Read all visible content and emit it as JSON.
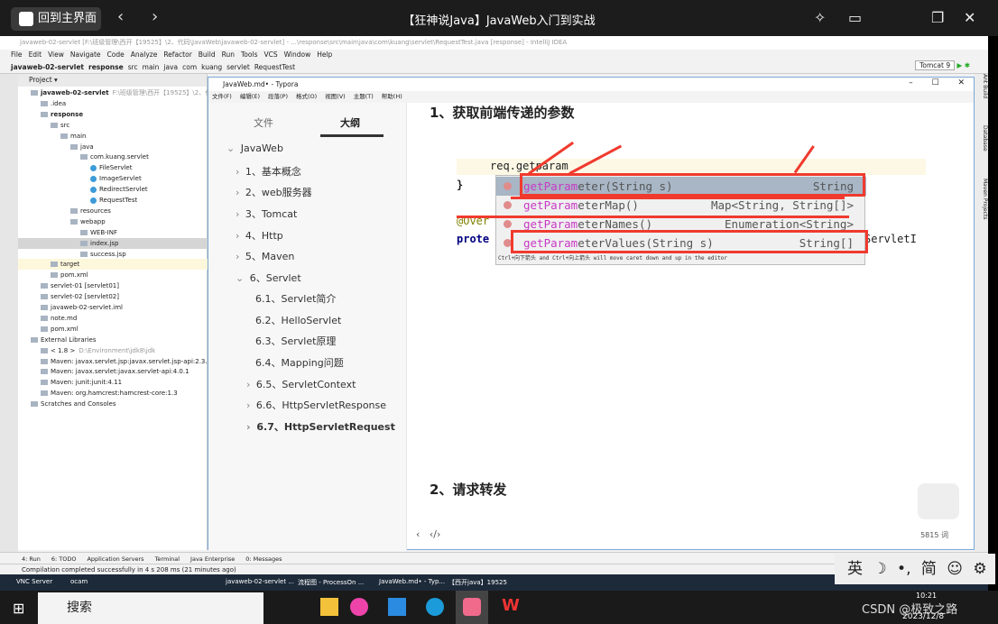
{
  "player": {
    "home_label": "回到主界面",
    "title": "【狂神说Java】JavaWeb入门到实战"
  },
  "ide": {
    "title": "javaweb-02-servlet [F:\\班级管理\\西开【19525】\\2、代码\\JavaWeb\\javaweb-02-servlet] - ...\\response\\src\\main\\java\\com\\kuang\\servlet\\RequestTest.java [response] - IntelliJ IDEA",
    "menu": [
      "File",
      "Edit",
      "View",
      "Navigate",
      "Code",
      "Analyze",
      "Refactor",
      "Build",
      "Run",
      "Tools",
      "VCS",
      "Window",
      "Help"
    ],
    "breadcrumbs": [
      "javaweb-02-servlet",
      "response",
      "src",
      "main",
      "java",
      "com",
      "kuang",
      "servlet",
      "RequestTest"
    ],
    "run_config": "Tomcat 9",
    "project_label": "Project",
    "tree": [
      {
        "t": "javaweb-02-servlet",
        "sub": "F:\\班级管理\\西开【19525】\\2、代码\\J",
        "d": 0,
        "b": true
      },
      {
        "t": ".idea",
        "d": 1
      },
      {
        "t": "response",
        "d": 1,
        "b": true
      },
      {
        "t": "src",
        "d": 2
      },
      {
        "t": "main",
        "d": 3
      },
      {
        "t": "java",
        "d": 4
      },
      {
        "t": "com.kuang.servlet",
        "d": 5
      },
      {
        "t": "FileServlet",
        "d": 6,
        "c": true
      },
      {
        "t": "ImageServlet",
        "d": 6,
        "c": true
      },
      {
        "t": "RedirectServlet",
        "d": 6,
        "c": true
      },
      {
        "t": "RequestTest",
        "d": 6,
        "c": true
      },
      {
        "t": "resources",
        "d": 4
      },
      {
        "t": "webapp",
        "d": 4
      },
      {
        "t": "WEB-INF",
        "d": 5
      },
      {
        "t": "index.jsp",
        "d": 5,
        "sel": true
      },
      {
        "t": "success.jsp",
        "d": 5
      },
      {
        "t": "target",
        "d": 2,
        "tg": true
      },
      {
        "t": "pom.xml",
        "d": 2
      },
      {
        "t": "servlet-01 [servlet01]",
        "d": 1
      },
      {
        "t": "servlet-02 [servlet02]",
        "d": 1
      },
      {
        "t": "javaweb-02-servlet.iml",
        "d": 1
      },
      {
        "t": "note.md",
        "d": 1
      },
      {
        "t": "pom.xml",
        "d": 1
      },
      {
        "t": "External Libraries",
        "d": 0
      },
      {
        "t": "< 1.8 >",
        "sub": "D:\\Environment\\jdk8\\jdk",
        "d": 1
      },
      {
        "t": "Maven: javax.servlet.jsp:javax.servlet.jsp-api:2.3.3",
        "d": 1
      },
      {
        "t": "Maven: javax.servlet:javax.servlet-api:4.0.1",
        "d": 1
      },
      {
        "t": "Maven: junit:junit:4.11",
        "d": 1
      },
      {
        "t": "Maven: org.hamcrest:hamcrest-core:1.3",
        "d": 1
      },
      {
        "t": "Scratches and Consoles",
        "d": 0
      }
    ],
    "right_tools": [
      "Ant Build",
      "Database",
      "Maven Projects"
    ],
    "bottom_tabs": [
      "4: Run",
      "6: TODO",
      "Application Servers",
      "Terminal",
      "Java Enterprise",
      "0: Messages"
    ],
    "status": "Compilation completed successfully in 4 s 208 ms (21 minutes ago)"
  },
  "typora": {
    "title": "JavaWeb.md• - Typora",
    "menu": [
      "文件(F)",
      "编辑(E)",
      "段落(P)",
      "格式(O)",
      "视图(V)",
      "主题(T)",
      "帮助(H)"
    ],
    "tabs": [
      "文件",
      "大纲"
    ],
    "outline": [
      "JavaWeb",
      "1、基本概念",
      "2、web服务器",
      "3、Tomcat",
      "4、Http",
      "5、Maven",
      "6、Servlet",
      "6.1、Servlet简介",
      "6.2、HelloServlet",
      "6.3、Servlet原理",
      "6.4、Mapping问题",
      "6.5、ServletContext",
      "6.6、HttpServletResponse",
      "6.7、HttpServletRequest"
    ],
    "heading1": "1、获取前端传递的参数",
    "heading2": "2、请求转发",
    "word_count": "5815 词",
    "code": {
      "line": "req.getparam",
      "brace": "}",
      "override": "@Over",
      "prote": "prote",
      "servlet": "ServletI",
      "completion": [
        {
          "hl": "getParam",
          "rest": "eter(String s)",
          "type": "String"
        },
        {
          "hl": "getParam",
          "rest": "eterMap()",
          "type": "Map<String, String[]>"
        },
        {
          "hl": "getParam",
          "rest": "eterNames()",
          "type": "Enumeration<String>"
        },
        {
          "hl": "getParam",
          "rest": "eterValues(String s)",
          "type": "String[]"
        }
      ],
      "hint": "Ctrl+向下箭头 and Ctrl+向上箭头 will move caret down and up in the editor"
    }
  },
  "inner_taskbar": [
    "VNC Server",
    "ocam",
    "javaweb-02-servlet ...",
    "流程图 - ProcessOn ...",
    "JavaWeb.md• - Typ...",
    "【西开java】19525"
  ],
  "taskbar": {
    "search": "搜索",
    "watermark": "CSDN @极致之路",
    "clock": "10:21",
    "date": "2023/12/8"
  },
  "ime": "英 ☽ •, 简 ☺ ⚙",
  "colors": {
    "highlight_box": "#f03a2e",
    "completion_match": "#c839c5"
  }
}
